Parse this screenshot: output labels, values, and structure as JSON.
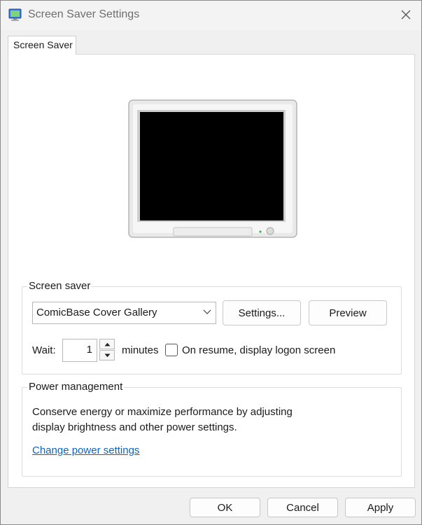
{
  "window": {
    "title": "Screen Saver Settings",
    "icons": {
      "app": "screen-saver-app-icon",
      "close": "close-icon"
    }
  },
  "tabs": [
    {
      "label": "Screen Saver",
      "selected": true
    }
  ],
  "preview_monitor": {
    "icon": "monitor-preview-icon",
    "screen_color": "#000000"
  },
  "screen_saver_group": {
    "title": "Screen saver",
    "selected_saver": "ComicBase Cover Gallery",
    "settings_label": "Settings...",
    "preview_label": "Preview",
    "wait_label": "Wait:",
    "wait_value": "1",
    "minutes_label": "minutes",
    "logon_checkbox_label": "On resume, display logon screen",
    "logon_checked": false
  },
  "power_group": {
    "title": "Power management",
    "description_line1": "Conserve energy or maximize performance by adjusting",
    "description_line2": "display brightness and other power settings.",
    "link_label": "Change power settings"
  },
  "footer": {
    "ok_label": "OK",
    "cancel_label": "Cancel",
    "apply_label": "Apply"
  },
  "colors": {
    "link": "#0a64c8",
    "window_bg": "#f0f0f0",
    "panel_bg": "#ffffff"
  }
}
